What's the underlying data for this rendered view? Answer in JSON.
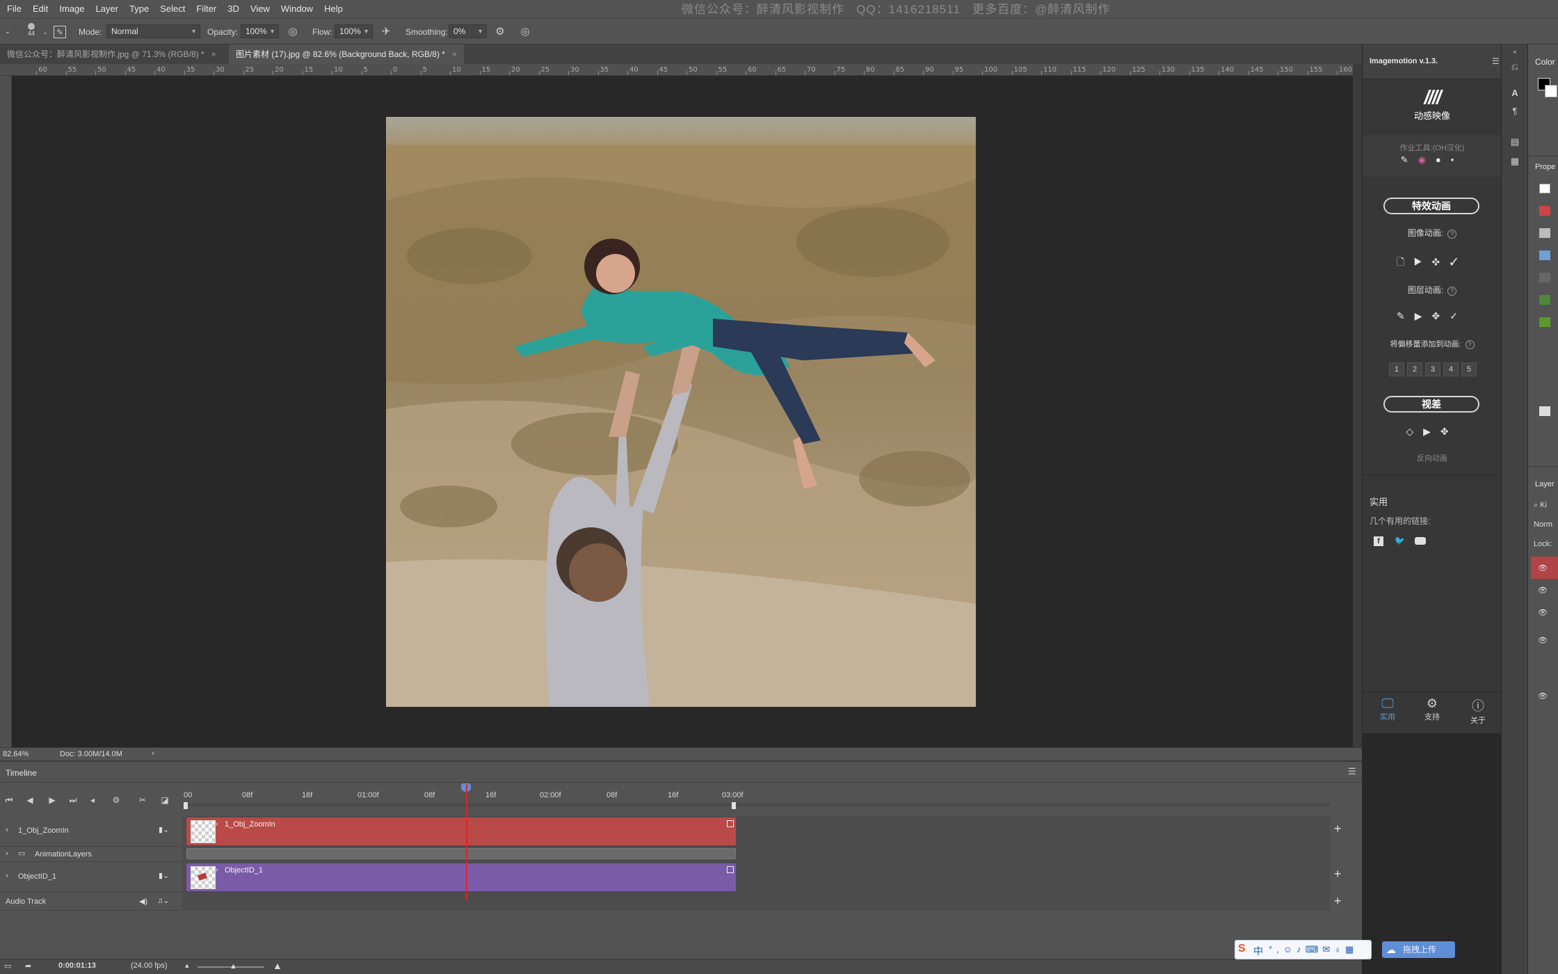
{
  "menu": {
    "items": [
      "File",
      "Edit",
      "Image",
      "Layer",
      "Type",
      "Select",
      "Filter",
      "3D",
      "View",
      "Window",
      "Help"
    ],
    "watermark": "微信公众号：醉清风影视制作   QQ：1416218511   更多百度：@醉清风制作"
  },
  "options": {
    "brush_size": "44",
    "mode_label": "Mode:",
    "mode_value": "Normal",
    "opacity_label": "Opacity:",
    "opacity_value": "100%",
    "flow_label": "Flow:",
    "flow_value": "100%",
    "smoothing_label": "Smoothing:",
    "smoothing_value": "0%"
  },
  "tabs": [
    {
      "label": "微信公众号：醉清风影视制作.jpg @ 71.3% (RGB/8) *",
      "close": "×"
    },
    {
      "label": "图片素材 (17).jpg @ 82.6% (Background Back, RGB/8) *",
      "close": "×"
    }
  ],
  "ruler": {
    "ticks": [
      "60",
      "55",
      "50",
      "45",
      "40",
      "35",
      "30",
      "25",
      "20",
      "15",
      "10",
      "5",
      "0",
      "5",
      "10",
      "15",
      "20",
      "25",
      "30",
      "35",
      "40",
      "45",
      "50",
      "55",
      "60",
      "65",
      "70",
      "75",
      "80",
      "85",
      "90",
      "95",
      "100",
      "105",
      "110",
      "115",
      "120",
      "125",
      "130",
      "135",
      "140",
      "145",
      "150",
      "155",
      "160"
    ]
  },
  "status": {
    "zoom": "82.64%",
    "doc": "Doc: 3.00M/14.0M",
    "arrow": "›"
  },
  "timeline": {
    "title": "Timeline",
    "time_ticks": [
      "00",
      "08f",
      "16f",
      "01:00f",
      "08f",
      "16f",
      "02:00f",
      "08f",
      "16f",
      "03:00f"
    ],
    "tracks": [
      {
        "name": "1_Obj_ZoomIn",
        "clip": "1_Obj_ZoomIn"
      },
      {
        "name": "AnimationLayers"
      },
      {
        "name": "ObjectID_1",
        "clip": "ObjectID_1"
      },
      {
        "name": "Audio Track"
      }
    ],
    "current_time": "0:00:01:13",
    "fps": "(24.00 fps)"
  },
  "plugin": {
    "title": "Imagemotion v.1.3.",
    "logo_text": "动感映像",
    "tools_label": "作业工具:(OH汉化)",
    "effects_button": "特效动画",
    "image_anim_label": "图像动画:",
    "layer_anim_label": "图层动画:",
    "offset_label": "将偏移量添加到动画:",
    "offset_numbers": [
      "1",
      "2",
      "3",
      "4",
      "5"
    ],
    "parallax_button": "视差",
    "reverse_label": "反向动画",
    "utility_title": "实用",
    "links_label": "几个有用的链接:",
    "bottom_tabs": [
      "实用",
      "支持",
      "关于"
    ]
  },
  "right_panel": {
    "color_title": "Color",
    "props_title": "Prope",
    "layers_title": "Layer",
    "layers_filter": "Ki",
    "layers_mode": "Norm",
    "lock_label": "Lock:"
  },
  "taskbar": {
    "ime_text": "中",
    "upload_text": "拖拽上传"
  },
  "colors": {
    "clip_red": "#b94a48",
    "clip_purple": "#7a5ba8",
    "playhead": "#d8262b",
    "accent_blue": "#5b9bd5"
  }
}
